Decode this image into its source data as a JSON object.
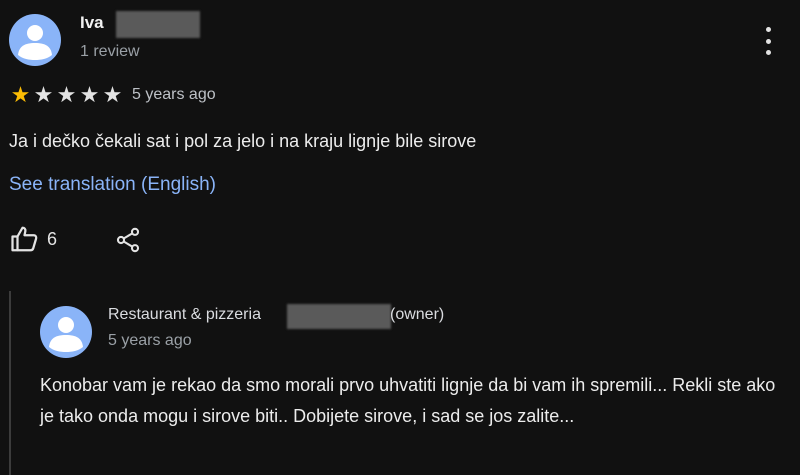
{
  "review": {
    "author": "Iva",
    "author_meta": "1 review",
    "rating": 1,
    "rating_max": 5,
    "time": "5 years ago",
    "text": "Ja i dečko čekali sat i pol za jelo i na kraju lignje bile sirove",
    "translation_link": "See translation (English)",
    "likes": "6",
    "icons": {
      "avatar": "person-icon",
      "more": "more-vert-icon",
      "like": "thumb-up-icon",
      "share": "share-icon"
    }
  },
  "reply": {
    "owner_name": "Restaurant & pizzeria",
    "owner_tag": "(owner)",
    "time": "5 years ago",
    "text": "Konobar vam je rekao da smo morali prvo uhvatiti lignje da bi vam ih spremili... Rekli ste ako je tako onda mogu i sirove biti.. Dobijete sirove, i sad se jos zalite..."
  },
  "colors": {
    "background": "#111111",
    "link": "#8ab4f8",
    "star": "#fbbc04",
    "avatar": "#8ab4f8"
  }
}
